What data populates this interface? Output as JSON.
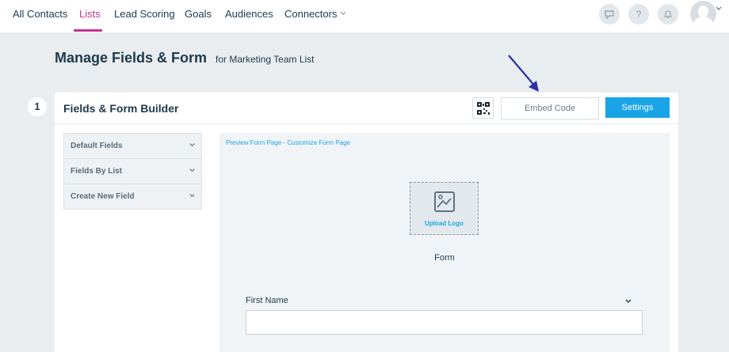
{
  "nav": {
    "items": [
      {
        "label": "All Contacts"
      },
      {
        "label": "Lists",
        "active": true
      },
      {
        "label": "Lead Scoring"
      },
      {
        "label": "Goals"
      },
      {
        "label": "Audiences"
      },
      {
        "label": "Connectors"
      }
    ],
    "help_label": "?",
    "accent_color": "#c2338f",
    "icons": [
      "chat-icon",
      "help-icon",
      "bell-icon",
      "avatar",
      "chevron-down-icon"
    ]
  },
  "header": {
    "title": "Manage Fields & Form",
    "subtitle": "for Marketing Team List"
  },
  "step": {
    "number": "1"
  },
  "card": {
    "title": "Fields & Form Builder",
    "embed_label": "Embed Code",
    "settings_label": "Settings",
    "primary_color": "#1aa4e8"
  },
  "sidebar": {
    "items": [
      {
        "label": "Default Fields"
      },
      {
        "label": "Fields By List"
      },
      {
        "label": "Create New Field"
      }
    ]
  },
  "preview": {
    "link_preview": "Preview Form Page",
    "link_separator": "-",
    "link_customize": "Customize Form Page",
    "upload_logo_label": "Upload Logo",
    "form_label": "Form",
    "field_label": "First Name"
  }
}
